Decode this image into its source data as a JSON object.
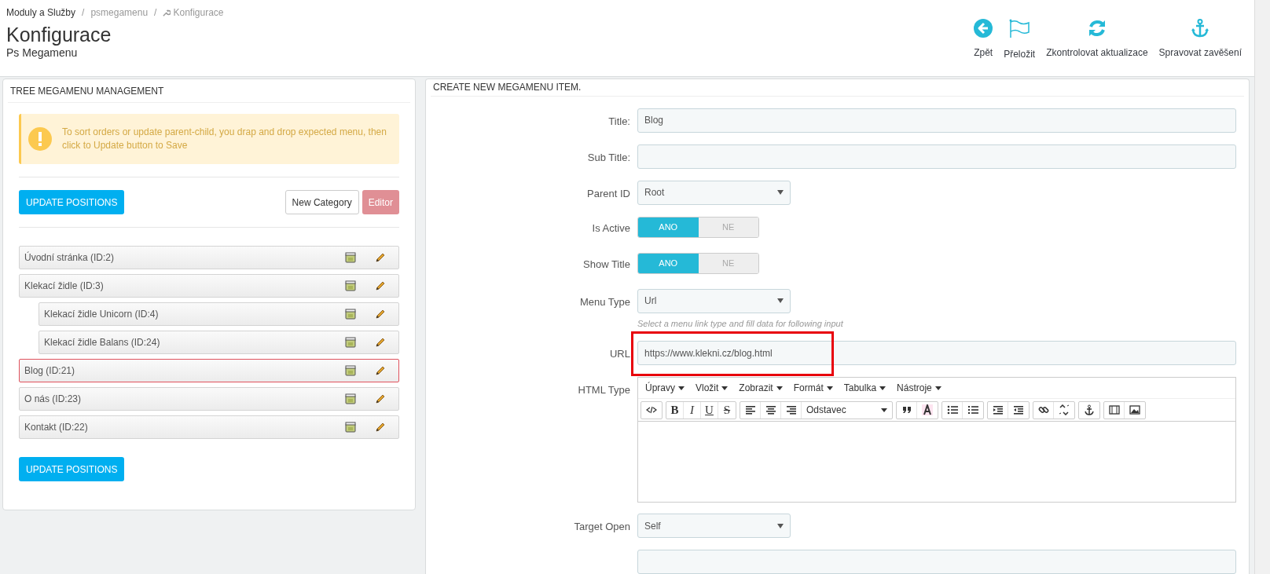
{
  "breadcrumb": [
    {
      "label": "Moduly a Služby",
      "kind": "link"
    },
    {
      "label": "psmegamenu",
      "kind": "muted"
    },
    {
      "label": "Konfigurace",
      "kind": "current"
    }
  ],
  "page": {
    "title": "Konfigurace",
    "subtitle": "Ps Megamenu"
  },
  "breadcrumb_separator": "/",
  "toolbar": [
    {
      "label": "Zpět"
    },
    {
      "label": "Přeložit"
    },
    {
      "label": "Zkontrolovat aktualizace"
    },
    {
      "label": "Spravovat zavěšení"
    }
  ],
  "tree_panel": {
    "title": "TREE MEGAMENU MANAGEMENT",
    "alert": "To sort orders or update parent-child, you drap and drop expected menu, then click to Update button to Save",
    "update_button": "UPDATE POSITIONS",
    "new_category_button": "New Category",
    "editor_button": "Editor",
    "items": [
      {
        "label": "Úvodní stránka (ID:2)",
        "selected": false
      },
      {
        "label": "Klekací židle (ID:3)",
        "selected": false,
        "children": [
          {
            "label": "Klekací židle Unicorn (ID:4)",
            "selected": false
          },
          {
            "label": "Klekací židle Balans (ID:24)",
            "selected": false
          }
        ]
      },
      {
        "label": "Blog (ID:21)",
        "selected": true
      },
      {
        "label": "O nás (ID:23)",
        "selected": false
      },
      {
        "label": "Kontakt (ID:22)",
        "selected": false
      }
    ],
    "bottom_button": "UPDATE POSITIONS"
  },
  "form_panel": {
    "title": "CREATE NEW MEGAMENU ITEM.",
    "fields": [
      {
        "kind": "text",
        "label": "Title:",
        "value": "Blog"
      },
      {
        "kind": "text",
        "label": "Sub Title:"
      },
      {
        "kind": "select",
        "label": "Parent ID",
        "value": "Root"
      },
      {
        "kind": "toggle",
        "label": "Is Active",
        "options": [
          {
            "label": "ANO",
            "selected": true
          },
          {
            "label": "NE",
            "selected": false
          }
        ]
      },
      {
        "kind": "toggle",
        "label": "Show Title",
        "options": [
          {
            "label": "ANO",
            "selected": true
          },
          {
            "label": "NE",
            "selected": false
          }
        ]
      },
      {
        "kind": "select",
        "label": "Menu Type",
        "value": "Url",
        "help": "Select a menu link type and fill data for following input"
      },
      {
        "kind": "text",
        "label": "URL",
        "value": "https://www.klekni.cz/blog.html",
        "highlighted": true
      },
      {
        "kind": "editor",
        "label": "HTML Type",
        "menus": [
          "Úpravy",
          "Vložit",
          "Zobrazit",
          "Formát",
          "Tabulka",
          "Nástroje"
        ],
        "format_value": "Odstavec",
        "letter_buttons": [
          "B",
          "I",
          "U",
          "S"
        ]
      },
      {
        "kind": "select",
        "label": "Target Open",
        "value": "Self"
      },
      {
        "kind": "partial"
      }
    ]
  }
}
